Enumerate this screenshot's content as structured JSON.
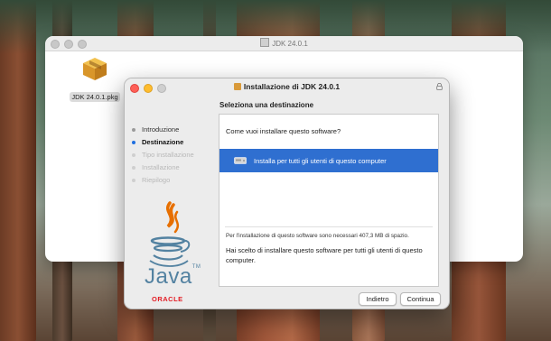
{
  "finder_window": {
    "title": "JDK 24.0.1",
    "file_label": "JDK 24.0.1.pkg"
  },
  "installer": {
    "title": "Installazione di JDK 24.0.1",
    "section_title": "Seleziona una destinazione",
    "steps": [
      {
        "label": "Introduzione",
        "state": "done"
      },
      {
        "label": "Destinazione",
        "state": "active"
      },
      {
        "label": "Tipo installazione",
        "state": "pending"
      },
      {
        "label": "Installazione",
        "state": "pending"
      },
      {
        "label": "Riepilogo",
        "state": "pending"
      }
    ],
    "question": "Come vuoi installare questo software?",
    "option_label": "Installa per tutti gli utenti di questo computer",
    "space_info": "Per l'installazione di questo software sono necessari 407,3 MB di spazio.",
    "chosen_text": "Hai scelto di installare questo software per tutti gli utenti di questo computer.",
    "back_button": "Indietro",
    "continue_button": "Continua",
    "brand": {
      "java_word": "Java",
      "trademark": "TM",
      "oracle_word": "ORACLE"
    }
  },
  "colors": {
    "accent": "#2f6fd0",
    "java_blue": "#5382a1",
    "java_orange": "#e76f00",
    "oracle_red": "#e31b23"
  }
}
